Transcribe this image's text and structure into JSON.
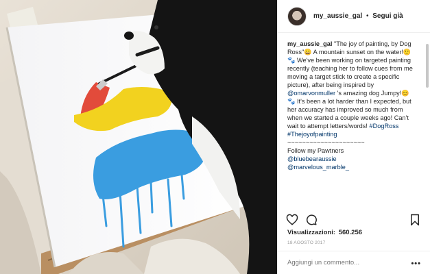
{
  "post": {
    "username": "my_aussie_gal",
    "separator": "•",
    "follow_state": "Segui già"
  },
  "caption": {
    "username": "my_aussie_gal",
    "text_1": " \"The joy of painting, by Dog Ross\"😀 A mountain sunset on the water!🙂🐾 We've been working on targeted painting recently (teaching her to follow cues from me moving a target stick to create a specific picture), after being inspired by ",
    "mention_1": "@omarvonmuller",
    "text_2": " 's amazing dog Jumpy!😊🐾 It's been a lot harder than I expected, but her accuracy has improved so much from when we started a couple weeks ago! Can't wait to attempt letters/words! ",
    "hashtag_1": "#DogRoss",
    "hashtag_2": "#Thejoyofpainting",
    "divider": "~~~~~~~~~~~~~~~~~~~~~",
    "follow_line": "Follow my Pawtners",
    "mention_2": "@bluebearaussie",
    "mention_3": "@marvelous_marble_"
  },
  "stats": {
    "views_label": "Visualizzazioni:",
    "views_count": "560.256",
    "date": "18 AGOSTO 2017"
  },
  "comment": {
    "placeholder": "Aggiungi un commento...",
    "more": "•••"
  },
  "icons": {
    "like": "heart-icon",
    "comment": "comment-icon",
    "save": "bookmark-icon",
    "more": "more-options-icon"
  },
  "colors": {
    "link": "#003569",
    "text": "#262626",
    "muted": "#999999"
  }
}
